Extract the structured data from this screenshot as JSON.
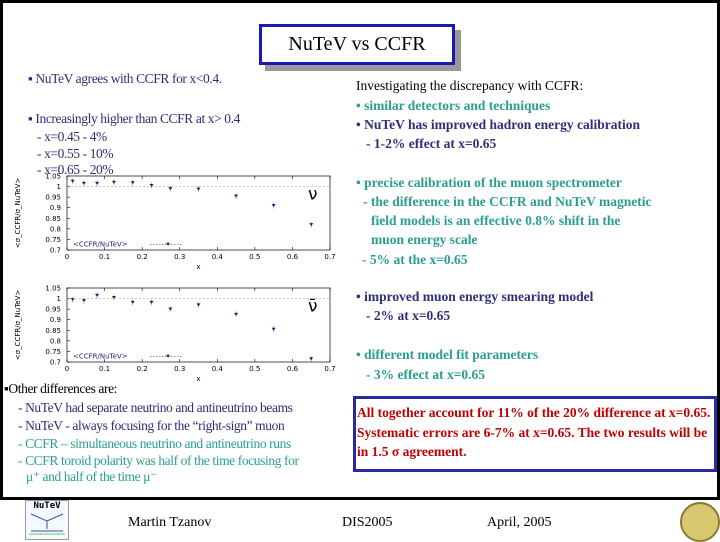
{
  "title": "NuTeV vs CCFR",
  "left": {
    "bullet1": "NuTeV agrees with CCFR for x<0.4.",
    "bullet2": "Increasingly higher than CCFR at x> 0.4",
    "sub": [
      "- x=0.45  - 4%",
      "- x=0.55  - 10%",
      "- x=0.65  - 20%"
    ]
  },
  "right": {
    "heading": "Investigating the discrepancy with CCFR:",
    "items": [
      "• similar detectors and techniques",
      "• NuTeV has improved hadron energy calibration",
      "- 1-2% effect  at  x=0.65",
      "• precise calibration of the muon spectrometer",
      "- the difference in the CCFR and NuTeV magnetic",
      "field models is an effective 0.8% shift in the",
      "muon  energy scale",
      "- 5% at the  x=0.65",
      "• improved muon energy smearing model",
      "- 2% at x=0.65",
      "• different model fit parameters",
      "- 3% effect at x=0.65"
    ]
  },
  "other": {
    "heading": "Other differences  are:",
    "items": [
      "- NuTeV had separate neutrino and antineutrino beams",
      "- NuTeV - always focusing for the “right-sign” muon",
      "- CCFR – simultaneous neutrino and antineutrino runs",
      "- CCFR toroid polarity was half of the time focusing for",
      "μ⁺ and half of the time μ⁻"
    ]
  },
  "conclusion": "All together account for 11% of the 20% difference at x=0.65. Systematic errors are 6-7% at x=0.65.  The two results will be in 1.5 σ agreement.",
  "footer": {
    "author": "Martin Tzanov",
    "conference": "DIS2005",
    "date": "April, 2005",
    "logo_text": "NuTeV"
  },
  "colors": {
    "blue_text": "#2e2e7a",
    "teal_text": "#2aa08c",
    "red_text": "#c00000",
    "box_border": "#2a2aa0",
    "marker": "#1a1a80"
  },
  "chart_data": [
    {
      "type": "scatter",
      "label": "ν",
      "ylabel": "<σ_CCFR/σ_NuTeV>",
      "xlabel": "x",
      "legend": "<CCFR/NuTeV>",
      "xlim": [
        0,
        0.7
      ],
      "ylim": [
        0.7,
        1.05
      ],
      "xticks": [
        "0",
        "0.1",
        "0.2",
        "0.3",
        "0.4",
        "0.5",
        "0.6",
        "0.7"
      ],
      "yticks": [
        "1.05",
        "1",
        "0.95",
        "0.9",
        "0.85",
        "0.8",
        "0.75",
        "0.7"
      ],
      "x": [
        0.015,
        0.045,
        0.08,
        0.125,
        0.175,
        0.225,
        0.275,
        0.35,
        0.45,
        0.55,
        0.65
      ],
      "y": [
        1.025,
        1.015,
        1.015,
        1.02,
        1.018,
        1.005,
        0.99,
        0.988,
        0.955,
        0.91,
        0.82
      ]
    },
    {
      "type": "scatter",
      "label": "ν̄",
      "ylabel": "<σ_CCFR/σ_NuTeV>",
      "xlabel": "x",
      "legend": "<CCFR/NuTeV>",
      "xlim": [
        0,
        0.7
      ],
      "ylim": [
        0.7,
        1.05
      ],
      "xticks": [
        "0",
        "0.1",
        "0.2",
        "0.3",
        "0.4",
        "0.5",
        "0.6",
        "0.7"
      ],
      "yticks": [
        "1.05",
        "1",
        "0.95",
        "0.9",
        "0.85",
        "0.8",
        "0.75",
        "0.7"
      ],
      "x": [
        0.015,
        0.045,
        0.08,
        0.125,
        0.175,
        0.225,
        0.275,
        0.35,
        0.45,
        0.55,
        0.65
      ],
      "y": [
        0.995,
        0.99,
        1.015,
        1.005,
        0.982,
        0.982,
        0.95,
        0.97,
        0.925,
        0.855,
        0.715
      ]
    }
  ]
}
